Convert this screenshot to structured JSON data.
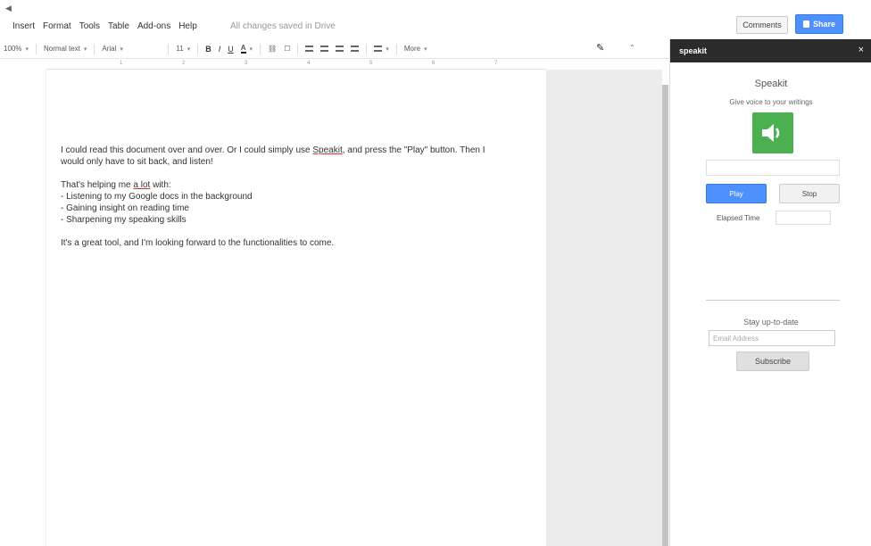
{
  "menubar": {
    "back": "◀",
    "items": [
      "Insert",
      "Format",
      "Tools",
      "Table",
      "Add-ons",
      "Help"
    ],
    "saved_status": "All changes saved in Drive",
    "comments_label": "Comments",
    "share_label": "Share"
  },
  "toolbar": {
    "zoom": "100%",
    "style": "Normal text",
    "font": "Arial",
    "size": "11",
    "bold": "B",
    "italic": "I",
    "underline": "U",
    "text_color": "A",
    "more": "More"
  },
  "ruler": {
    "ticks": [
      "1",
      "2",
      "3",
      "4",
      "5",
      "6",
      "7"
    ]
  },
  "document": {
    "para1_before": "I could read this document over and over. Or I could simply use ",
    "para1_link": "Speakit",
    "para1_after": ", and press the \"Play\" button. Then I would only have to sit back, and listen!",
    "para2_before": "That's helping me ",
    "para2_spell": "a lot",
    "para2_after": " with:",
    "bullets": [
      "- Listening to my Google docs in the background",
      "- Gaining insight on reading time",
      "- Sharpening my speaking skills"
    ],
    "para3": "It's a great tool, and I'm looking forward to the functionalities to come."
  },
  "sidebar": {
    "header": "speakit",
    "close": "×",
    "title": "Speakit",
    "tagline": "Give voice to your writings",
    "speaker_icon": "speaker-icon",
    "play_label": "Play",
    "stop_label": "Stop",
    "elapsed_label": "Elapsed Time",
    "stay_label": "Stay up-to-date",
    "email_placeholder": "Email Address",
    "subscribe_label": "Subscribe"
  },
  "colors": {
    "accent": "#4d90fe",
    "speaker_green": "#4caf50",
    "sidebar_header": "#2b2b2b"
  }
}
